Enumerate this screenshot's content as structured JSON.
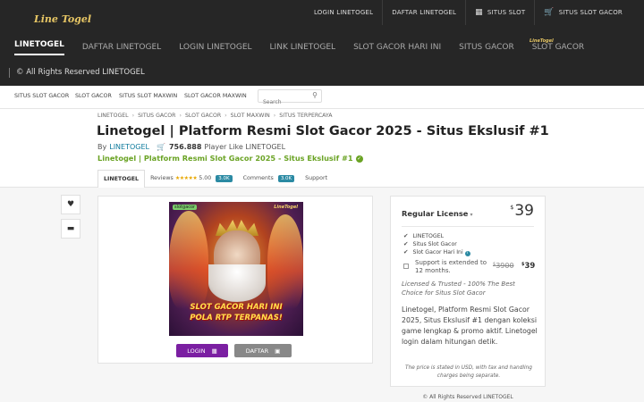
{
  "brand": {
    "logo_text_left": "Line",
    "logo_text_right": "Togel",
    "nav_logo_text": "LineTogel"
  },
  "top_links": [
    {
      "label": "LOGIN LINETOGEL"
    },
    {
      "label": "DAFTAR LINETOGEL"
    },
    {
      "label": "SITUS SLOT",
      "icon": "grid-icon"
    },
    {
      "label": "SITUS SLOT GACOR",
      "icon": "cart-icon"
    }
  ],
  "main_nav": [
    {
      "label": "LINETOGEL",
      "active": true
    },
    {
      "label": "DAFTAR LINETOGEL"
    },
    {
      "label": "LOGIN LINETOGEL"
    },
    {
      "label": "LINK LINETOGEL"
    },
    {
      "label": "SLOT GACOR HARI INI"
    },
    {
      "label": "SITUS GACOR"
    },
    {
      "label": "SLOT GACOR"
    }
  ],
  "copyright_bar": "© All Rights Reserved LINETOGEL",
  "sub_nav": [
    "SITUS SLOT GACOR",
    "SLOT GACOR",
    "SITUS SLOT MAXWIN",
    "SLOT GACOR MAXWIN"
  ],
  "search": {
    "placeholder": "Search"
  },
  "breadcrumbs": [
    "LINETOGEL",
    "SITUS GACOR",
    "SLOT GACOR",
    "SLOT MAXWIN",
    "SITUS TERPERCAYA"
  ],
  "product": {
    "title": "Linetogel | Platform Resmi Slot Gacor 2025 - Situs Ekslusif #1",
    "by_label": "By",
    "author": "LINETOGEL",
    "sales": "756.888",
    "sales_label": "Player Like LINETOGEL",
    "tagline": "Linetogel | Platform Resmi Slot Gacor 2025 - Situs Ekslusif #1"
  },
  "tabs": {
    "item": "LINETOGEL",
    "reviews_label": "Reviews",
    "stars": "★★★★★",
    "rating": "5.00",
    "reviews_count": "3.0K",
    "comments_label": "Comments",
    "comments_count": "3.0K",
    "support": "Support"
  },
  "preview": {
    "mini_logo": "slotgacor",
    "mini_logo2": "LineTogel",
    "promo_line1": "SLOT GACOR HARI INI",
    "promo_line2": "POLA RTP TERPANAS!",
    "login_btn": "LOGIN",
    "daftar_btn": "DAFTAR"
  },
  "license": {
    "title": "Regular License",
    "currency": "$",
    "price": "39",
    "features": [
      "LINETOGEL",
      "Situs Slot Gacor",
      "Slot Gacor Hari Ini"
    ],
    "support_text": "Support is extended to 12 months.",
    "old_price": "3900",
    "new_price": "39",
    "licensed": "Licensed & Trusted - 100% The Best Choice for Situs Slot Gacor",
    "description": "Linetogel, Platform Resmi Slot Gacor 2025, Situs Ekslusif #1 dengan koleksi game lengkap & promo aktif. Linetogel login dalam hitungan detik.",
    "fine_print": "The price is stated in USD, with tax and handling charges being separate."
  },
  "footer_copy": "© All Rights Reserved LINETOGEL",
  "colors": {
    "topbar": "#262626",
    "accent_green": "#6aa324",
    "login_purple": "#7b1fa2",
    "badge_teal": "#2b8aa3"
  }
}
